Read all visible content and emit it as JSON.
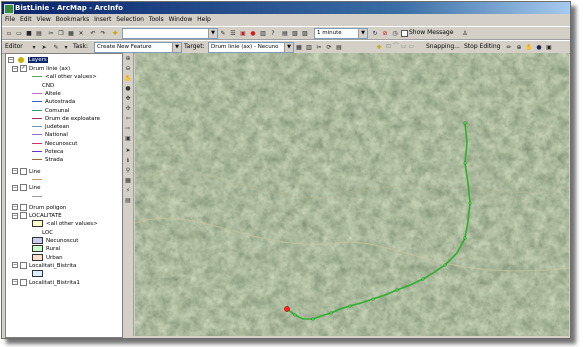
{
  "window": {
    "title": "BistLinie - ArcMap - ArcInfo"
  },
  "menu": [
    "File",
    "Edit",
    "View",
    "Bookmarks",
    "Insert",
    "Selection",
    "Tools",
    "Window",
    "Help"
  ],
  "standard_toolbar": {
    "scale_value": "",
    "interval_value": "1 minute",
    "show_message_label": "Show Message"
  },
  "editor_toolbar": {
    "editor_label": "Editor",
    "task_label": "Task:",
    "task_value": "Create New Feature",
    "target_label": "Target:",
    "target_value": "Drum linie (ax) - Necuno",
    "snapping_label": "Snapping...",
    "stop_editing_label": "Stop Editing"
  },
  "toc": {
    "root": "Layers",
    "items": [
      {
        "kind": "layer",
        "label": "Drum linie (ax)",
        "checked": true
      },
      {
        "kind": "legend",
        "label": "<all other values>",
        "color": "#55aa55",
        "type": "line"
      },
      {
        "kind": "legend",
        "label": "CND",
        "color": "#ffffff",
        "type": "none"
      },
      {
        "kind": "legend",
        "label": "Altele",
        "color": "#cc66cc",
        "type": "line"
      },
      {
        "kind": "legend",
        "label": "Autostrada",
        "color": "#3366cc",
        "type": "line"
      },
      {
        "kind": "legend",
        "label": "Comunal",
        "color": "#339966",
        "type": "line"
      },
      {
        "kind": "legend",
        "label": "Drum de exploatare",
        "color": "#993366",
        "type": "line"
      },
      {
        "kind": "legend",
        "label": "Judetean",
        "color": "#6699cc",
        "type": "line"
      },
      {
        "kind": "legend",
        "label": "National",
        "color": "#9966cc",
        "type": "line"
      },
      {
        "kind": "legend",
        "label": "Necunoscut",
        "color": "#cc3366",
        "type": "line"
      },
      {
        "kind": "legend",
        "label": "Poteca",
        "color": "#6633cc",
        "type": "line"
      },
      {
        "kind": "legend",
        "label": "Strada",
        "color": "#996633",
        "type": "line"
      },
      {
        "kind": "spacer"
      },
      {
        "kind": "layer",
        "label": "Line",
        "checked": false
      },
      {
        "kind": "legend",
        "label": "",
        "color": "#cc9966",
        "type": "line"
      },
      {
        "kind": "layer",
        "label": "Line",
        "checked": false
      },
      {
        "kind": "legend",
        "label": "",
        "color": "#999999",
        "type": "line"
      },
      {
        "kind": "spacer"
      },
      {
        "kind": "layer",
        "label": "Drum poligon",
        "checked": false
      },
      {
        "kind": "layer",
        "label": "LOCALITATE",
        "checked": false
      },
      {
        "kind": "legend",
        "label": "<all other values>",
        "color": "#ffffcc",
        "type": "swatch"
      },
      {
        "kind": "legend",
        "label": "LOC",
        "color": "#ffffff",
        "type": "none"
      },
      {
        "kind": "legend",
        "label": "Necunoscut",
        "color": "#ccccee",
        "type": "swatch"
      },
      {
        "kind": "legend",
        "label": "Rural",
        "color": "#ccffcc",
        "type": "swatch"
      },
      {
        "kind": "legend",
        "label": "Urban",
        "color": "#ffe0cc",
        "type": "swatch"
      },
      {
        "kind": "layer",
        "label": "Localitati_Bistrita",
        "checked": false
      },
      {
        "kind": "legend",
        "label": "",
        "color": "#ddeeff",
        "type": "swatch"
      },
      {
        "kind": "layer",
        "label": "Localitati_Bistrita1",
        "checked": false
      }
    ]
  },
  "colors": {
    "title_bar": "#0a246a",
    "chrome": "#d4d0c8",
    "edit_vertex": "#33bb33",
    "edit_point": "#ff2222"
  }
}
